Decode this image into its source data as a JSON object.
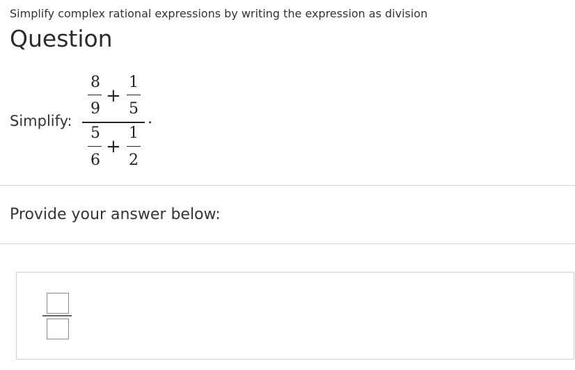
{
  "topic": "Simplify complex rational expressions by writing the expression as division",
  "heading": "Question",
  "prompt": {
    "label": "Simplify:",
    "expression": {
      "numerator": {
        "left": {
          "top": "8",
          "bottom": "9"
        },
        "operator": "+",
        "right": {
          "top": "1",
          "bottom": "5"
        }
      },
      "denominator": {
        "left": {
          "top": "5",
          "bottom": "6"
        },
        "operator": "+",
        "right": {
          "top": "1",
          "bottom": "2"
        }
      },
      "end": "."
    }
  },
  "answer": {
    "label": "Provide your answer below:"
  }
}
